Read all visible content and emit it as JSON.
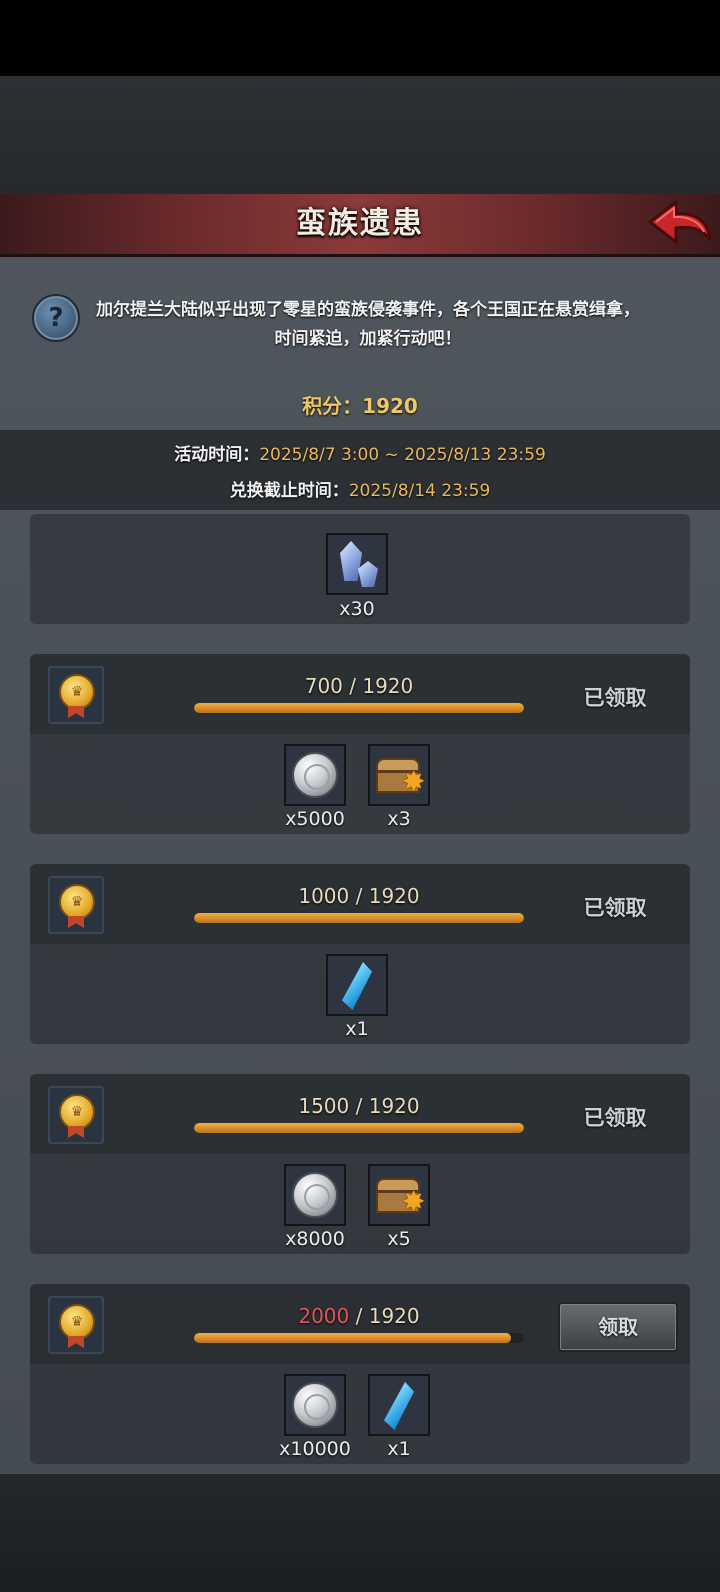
{
  "header": {
    "title": "蛮族遗患",
    "back_icon": "back-arrow-icon"
  },
  "intro": {
    "description": "加尔提兰大陆似乎出现了零星的蛮族侵袭事件，各个王国正在悬赏缉拿，时间紧迫，加紧行动吧！",
    "help_icon": "question-mark-icon"
  },
  "score": {
    "label": "积分：",
    "value": "1920"
  },
  "times": {
    "event_label": "活动时间：",
    "event_value": "2025/8/7 3:00 ~ 2025/8/13 23:59",
    "exchange_label": "兑换截止时间：",
    "exchange_value": "2025/8/14 23:59"
  },
  "partial_card": {
    "items": [
      {
        "icon": "blue-gems-icon",
        "qty": "x30"
      }
    ]
  },
  "tiers": [
    {
      "current": "700",
      "separator": " / ",
      "target": "1920",
      "progress": 1.0,
      "status": "已领取",
      "items": [
        {
          "icon": "silver-coin-icon",
          "qty": "x5000"
        },
        {
          "icon": "treasure-chest-icon",
          "qty": "x3"
        }
      ]
    },
    {
      "current": "1000",
      "separator": " / ",
      "target": "1920",
      "progress": 1.0,
      "status": "已领取",
      "items": [
        {
          "icon": "blue-crystal-icon",
          "qty": "x1"
        }
      ]
    },
    {
      "current": "1500",
      "separator": " / ",
      "target": "1920",
      "progress": 1.0,
      "status": "已领取",
      "items": [
        {
          "icon": "silver-coin-icon",
          "qty": "x8000"
        },
        {
          "icon": "treasure-chest-icon",
          "qty": "x5"
        }
      ]
    },
    {
      "current": "2000",
      "separator": " / ",
      "target": "1920",
      "progress": 0.96,
      "status": "领取",
      "items": [
        {
          "icon": "silver-coin-icon",
          "qty": "x10000"
        },
        {
          "icon": "blue-crystal-icon",
          "qty": "x1"
        }
      ]
    }
  ],
  "colors": {
    "accent_gold": "#f0c766",
    "title_red": "#8c3a3a",
    "bar_orange": "#d7892a",
    "insufficient_red": "#e0575a"
  }
}
